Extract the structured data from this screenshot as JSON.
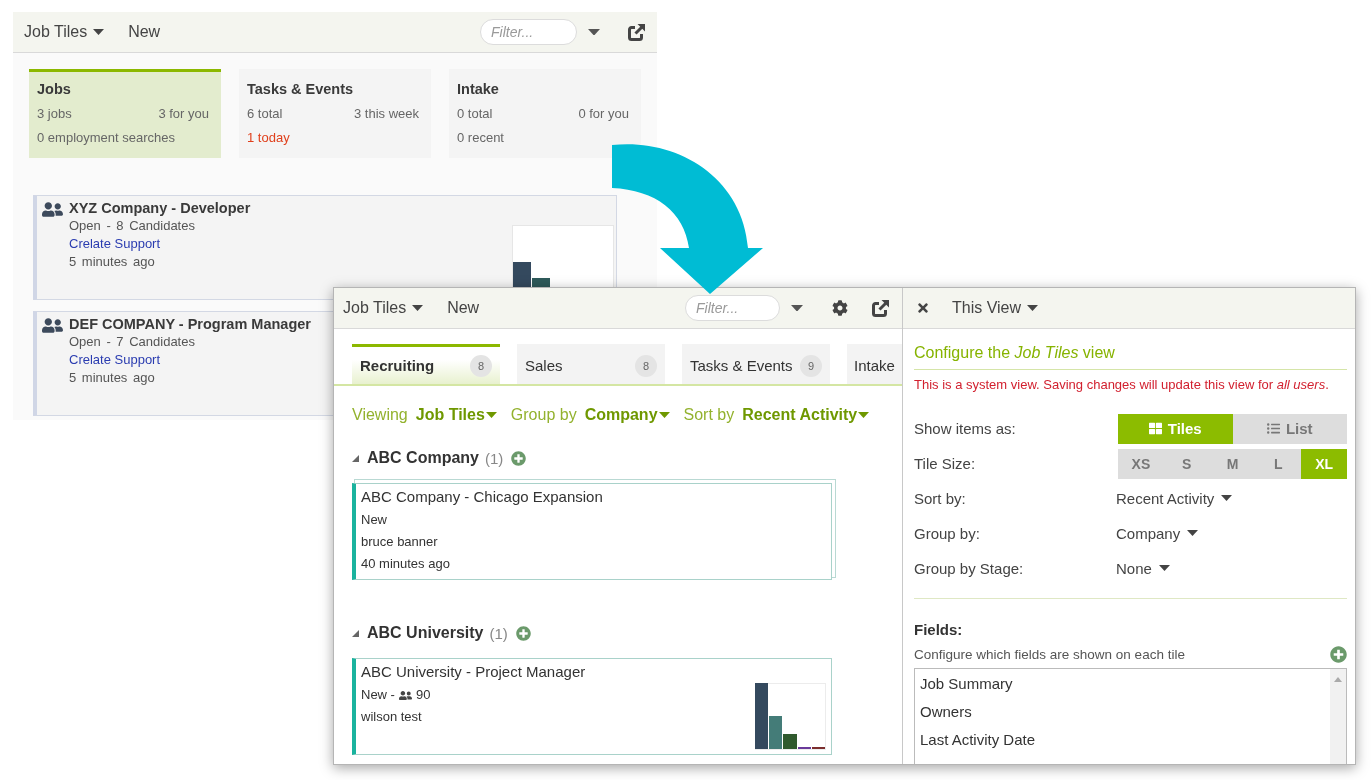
{
  "background_window": {
    "toolbar": {
      "view_menu": "Job Tiles",
      "new_button": "New",
      "filter": {
        "placeholder": "Filter..."
      }
    },
    "summary_tiles": [
      {
        "title": "Jobs",
        "selected": true,
        "lines": [
          {
            "left": "3 jobs",
            "right": "3 for you",
            "alert": false
          },
          {
            "left": "0 employment searches",
            "alert": false
          }
        ]
      },
      {
        "title": "Tasks & Events",
        "selected": false,
        "lines": [
          {
            "left": "6 total",
            "right": "3 this week",
            "alert": false
          },
          {
            "left": "1 today",
            "alert": true
          }
        ]
      },
      {
        "title": "Intake",
        "selected": false,
        "lines": [
          {
            "left": "0 total",
            "right": "0 for you",
            "alert": false
          },
          {
            "left": "0 recent",
            "alert": false
          }
        ]
      }
    ],
    "job_cards": [
      {
        "title": "XYZ Company - Developer",
        "status": "Open - 8 Candidates",
        "owner": "Crelate Support",
        "updated": "5 minutes ago",
        "activity_chart": true
      },
      {
        "title": "DEF COMPANY - Program Manager",
        "status": "Open - 7 Candidates",
        "owner": "Crelate Support",
        "updated": "5 minutes ago"
      }
    ]
  },
  "main_window": {
    "toolbar": {
      "view_menu": "Job Tiles",
      "new_button": "New",
      "filter": {
        "placeholder": "Filter..."
      }
    },
    "tabs": [
      {
        "label": "Recruiting",
        "count": "8",
        "selected": true
      },
      {
        "label": "Sales",
        "count": "8",
        "selected": false
      },
      {
        "label": "Tasks & Events",
        "count": "9",
        "selected": false
      },
      {
        "label": "Intake",
        "selected": false
      }
    ],
    "view_options": [
      {
        "label": "Viewing",
        "value": "Job Tiles"
      },
      {
        "label": "Group by",
        "value": "Company"
      },
      {
        "label": "Sort by",
        "value": "Recent Activity"
      }
    ],
    "groups": [
      {
        "name": "ABC Company",
        "count": "(1)",
        "expanded": true,
        "tiles": [
          {
            "title": "ABC Company - Chicago Expansion",
            "status": "New",
            "owner": "bruce banner",
            "updated": "40 minutes ago",
            "stacked": true,
            "activity_chart": false
          }
        ]
      },
      {
        "name": "ABC University",
        "count": "(1)",
        "expanded": true,
        "tiles": [
          {
            "title": "ABC University - Project Manager",
            "status": "New -",
            "candidates": "90",
            "owner": "wilson test",
            "stacked": false,
            "activity_chart": true
          }
        ]
      }
    ]
  },
  "config_panel": {
    "view_menu": "This View",
    "heading": "Configure the *Job Tiles* view",
    "warning": "This is a system view. Saving changes will update this view for *all users*.",
    "settings": [
      {
        "kind": "segmented",
        "label": "Show items as:",
        "options": [
          {
            "label": "Tiles",
            "kind": "grid",
            "selected": true
          },
          {
            "label": "List",
            "kind": "list",
            "selected": false
          }
        ]
      },
      {
        "kind": "segmented",
        "label": "Tile Size:",
        "options": [
          {
            "label": "XS",
            "kind": "plain",
            "selected": false
          },
          {
            "label": "S",
            "kind": "plain",
            "selected": false
          },
          {
            "label": "M",
            "kind": "plain",
            "selected": false
          },
          {
            "label": "L",
            "kind": "plain",
            "selected": false
          },
          {
            "label": "XL",
            "kind": "plain",
            "selected": true
          }
        ]
      },
      {
        "kind": "dropdown",
        "label": "Sort by:",
        "value": "Recent Activity"
      },
      {
        "kind": "dropdown",
        "label": "Group by:",
        "value": "Company"
      },
      {
        "kind": "dropdown",
        "label": "Group by Stage:",
        "value": "None"
      }
    ],
    "fields": {
      "title": "Fields:",
      "description": "Configure which fields are shown on each tile",
      "items": [
        "Job Summary",
        "Owners",
        "Last Activity Date"
      ]
    }
  }
}
